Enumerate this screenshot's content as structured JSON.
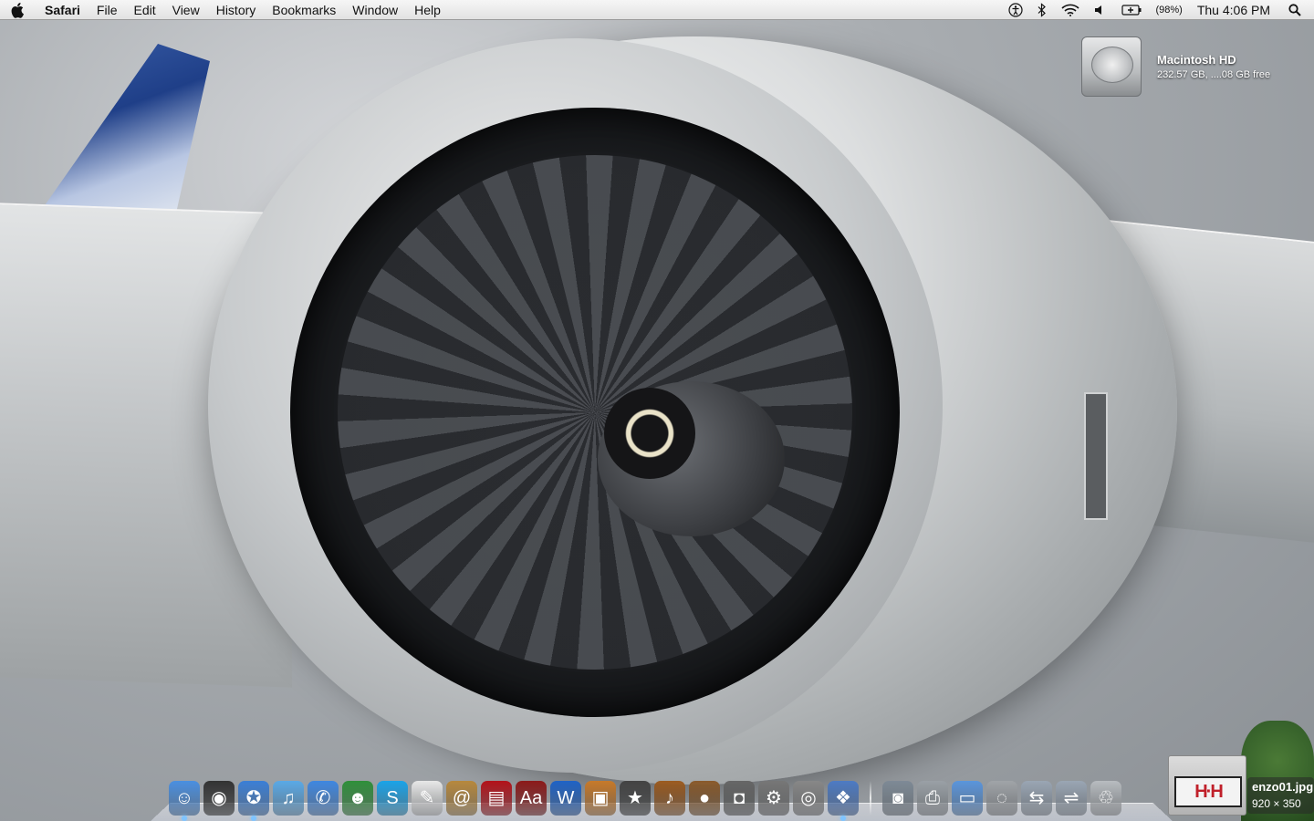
{
  "menubar": {
    "app_name": "Safari",
    "menus": [
      "File",
      "Edit",
      "View",
      "History",
      "Bookmarks",
      "Window",
      "Help"
    ],
    "status": {
      "battery_percent": "(98%)",
      "clock": "Thu 4:06 PM"
    },
    "icons": [
      "apple-icon",
      "accessibility-icon",
      "bluetooth-icon",
      "wifi-icon",
      "volume-icon",
      "battery-icon",
      "spotlight-icon"
    ]
  },
  "desktop": {
    "drive": {
      "name": "Macintosh HD",
      "info": "232.57 GB, ....08 GB free"
    }
  },
  "dock": {
    "apps": [
      {
        "name": "finder-icon",
        "glyph": "☺",
        "color": "#4a8fe0"
      },
      {
        "name": "dashboard-icon",
        "glyph": "◉",
        "color": "#333333"
      },
      {
        "name": "safari-icon",
        "glyph": "✪",
        "color": "#3b7fd6"
      },
      {
        "name": "itunes-icon",
        "glyph": "♫",
        "color": "#5aa9e6"
      },
      {
        "name": "ichat-icon",
        "glyph": "✆",
        "color": "#3f87e0"
      },
      {
        "name": "messenger-icon",
        "glyph": "☻",
        "color": "#2f8f3a"
      },
      {
        "name": "skype-icon",
        "glyph": "S",
        "color": "#1aa3e8"
      },
      {
        "name": "textedit-icon",
        "glyph": "✎",
        "color": "#e8e8e8"
      },
      {
        "name": "address-book-icon",
        "glyph": "@",
        "color": "#b7883c"
      },
      {
        "name": "photo-booth-icon",
        "glyph": "▤",
        "color": "#b3121a"
      },
      {
        "name": "dictionary-icon",
        "glyph": "Aa",
        "color": "#8c1a1a"
      },
      {
        "name": "word-icon",
        "glyph": "W",
        "color": "#1f63c6"
      },
      {
        "name": "iphoto-icon",
        "glyph": "▣",
        "color": "#c87a2a"
      },
      {
        "name": "imovie-icon",
        "glyph": "★",
        "color": "#444444"
      },
      {
        "name": "garageband-icon",
        "glyph": "♪",
        "color": "#9b5a1f"
      },
      {
        "name": "coconut-icon",
        "glyph": "●",
        "color": "#8a5a2b"
      },
      {
        "name": "image-capture-icon",
        "glyph": "◘",
        "color": "#666666"
      },
      {
        "name": "system-preferences-icon",
        "glyph": "⚙",
        "color": "#777777"
      },
      {
        "name": "dvd-player-icon",
        "glyph": "◎",
        "color": "#888888"
      },
      {
        "name": "preview-icon",
        "glyph": "❖",
        "color": "#4d7bc4"
      }
    ],
    "stacks": [
      {
        "name": "camera-folder-icon",
        "glyph": "◙",
        "color": "#7e8a96"
      },
      {
        "name": "printer-icon",
        "glyph": "⎙",
        "color": "#9aa0a6"
      },
      {
        "name": "folder-icon",
        "glyph": "▭",
        "color": "#5a95dc"
      },
      {
        "name": "disk-utility-icon",
        "glyph": "◌",
        "color": "#a0a4a8"
      },
      {
        "name": "network-icon",
        "glyph": "⇆",
        "color": "#9aa6b4"
      },
      {
        "name": "network-drive-icon",
        "glyph": "⇌",
        "color": "#9aa6b4"
      },
      {
        "name": "trash-icon",
        "glyph": "♲",
        "color": "#b8bcc0"
      }
    ]
  },
  "drag": {
    "filename": "enzo01.jpg",
    "dimensions": "920 × 350"
  }
}
